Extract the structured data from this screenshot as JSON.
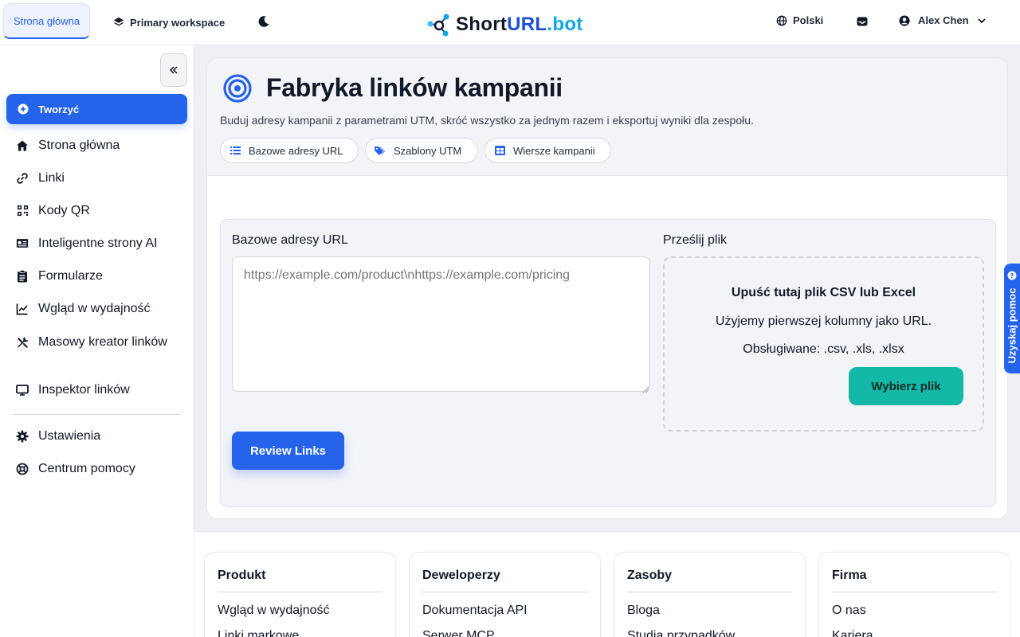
{
  "topbar": {
    "home_tab": "Strona główna",
    "workspace": "Primary workspace",
    "logo": {
      "part1": "Short",
      "part2": "URL",
      "part3": ".bot"
    },
    "language": "Polski",
    "user_name": "Alex Chen"
  },
  "sidebar": {
    "create_label": "Tworzyć",
    "items": [
      {
        "label": "Strona główna",
        "icon": "home-icon"
      },
      {
        "label": "Linki",
        "icon": "link-icon"
      },
      {
        "label": "Kody QR",
        "icon": "qr-icon"
      },
      {
        "label": "Inteligentne strony AI",
        "icon": "id-card-icon"
      },
      {
        "label": "Formularze",
        "icon": "clipboard-icon"
      },
      {
        "label": "Wgląd w wydajność",
        "icon": "line-chart-icon"
      },
      {
        "label": "Masowy kreator linków",
        "icon": "tools-icon"
      },
      {
        "label": "Inspektor linków",
        "icon": "monitor-icon"
      }
    ],
    "bottom_items": [
      {
        "label": "Ustawienia",
        "icon": "gear-icon"
      },
      {
        "label": "Centrum pomocy",
        "icon": "lifebuoy-icon"
      }
    ]
  },
  "main": {
    "title": "Fabryka linków kampanii",
    "subtitle": "Buduj adresy kampanii z parametrami UTM, skróć wszystko za jednym razem i eksportuj wyniki dla zespołu.",
    "chips": [
      {
        "label": "Bazowe adresy URL",
        "icon": "list-icon"
      },
      {
        "label": "Szablony UTM",
        "icon": "tags-icon"
      },
      {
        "label": "Wiersze kampanii",
        "icon": "table-icon"
      }
    ],
    "urls_label": "Bazowe adresy URL",
    "urls_placeholder": "https://example.com/product\\nhttps://example.com/pricing",
    "review_button": "Review Links",
    "upload_label": "Prześlij plik",
    "drop_title": "Upuść tutaj plik CSV lub Excel",
    "drop_hint": "Użyjemy pierwszej kolumny jako URL.",
    "drop_formats": "Obsługiwane: .csv, .xls, .xlsx",
    "choose_file_button": "Wybierz plik"
  },
  "help_tab": "Uzyskaj pomoc",
  "footer": {
    "columns": [
      {
        "heading": "Produkt",
        "links": [
          "Wgląd w wydajność",
          "Linki markowe"
        ]
      },
      {
        "heading": "Deweloperzy",
        "links": [
          "Dokumentacja API",
          "Serwer MCP"
        ]
      },
      {
        "heading": "Zasoby",
        "links": [
          "Bloga",
          "Studia przypadków"
        ]
      },
      {
        "heading": "Firma",
        "links": [
          "O nas",
          "Kariera"
        ]
      }
    ]
  },
  "colors": {
    "primary": "#2563eb",
    "accent_teal": "#14b8a6",
    "logo_cyan": "#0ea5e9",
    "text": "#111827"
  }
}
